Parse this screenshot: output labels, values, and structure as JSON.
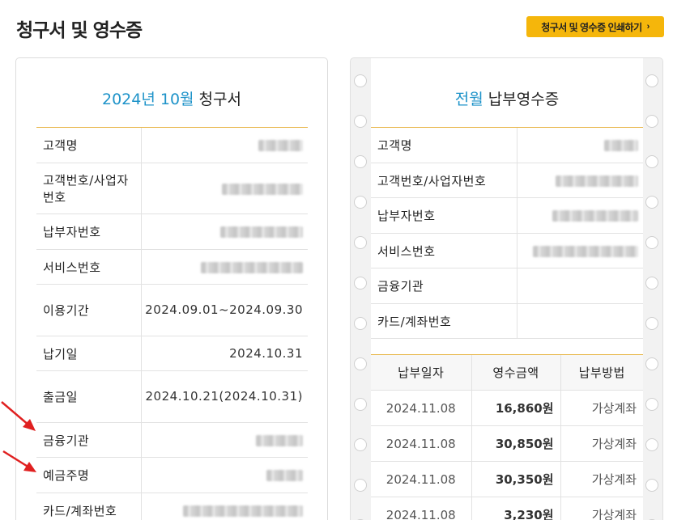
{
  "page": {
    "title": "청구서 및 영수증",
    "print_button": "청구서 및 영수증 인쇄하기"
  },
  "bill": {
    "title_accent": "2024년 10월",
    "title_rest": " 청구서",
    "rows": [
      {
        "label": "고객명",
        "value": "",
        "masked": true,
        "mask_w": 55
      },
      {
        "label": "고객번호/사업자번호",
        "value": "",
        "masked": true,
        "mask_w": 100
      },
      {
        "label": "납부자번호",
        "value": "",
        "masked": true,
        "mask_w": 102
      },
      {
        "label": "서비스번호",
        "value": "",
        "masked": true,
        "mask_w": 126
      },
      {
        "label": "이용기간",
        "value": "2024.09.01~2024.09.30",
        "masked": false
      },
      {
        "label": "납기일",
        "value": "2024.10.31",
        "masked": false
      },
      {
        "label": "출금일",
        "value": "2024.10.21(2024.10.31)",
        "masked": false
      },
      {
        "label": "금융기관",
        "value": "",
        "masked": true,
        "mask_w": 58
      },
      {
        "label": "예금주명",
        "value": "",
        "masked": true,
        "mask_w": 45
      },
      {
        "label": "카드/계좌번호",
        "value": "",
        "masked": true,
        "mask_w": 148
      }
    ]
  },
  "receipt": {
    "title_accent": "전월",
    "title_rest": " 납부영수증",
    "rows": [
      {
        "label": "고객명",
        "value": "",
        "masked": true,
        "mask_w": 42
      },
      {
        "label": "고객번호/사업자번호",
        "value": "",
        "masked": true,
        "mask_w": 102
      },
      {
        "label": "납부자번호",
        "value": "",
        "masked": true,
        "mask_w": 106
      },
      {
        "label": "서비스번호",
        "value": "",
        "masked": true,
        "mask_w": 130
      },
      {
        "label": "금융기관",
        "value": "",
        "masked": false
      },
      {
        "label": "카드/계좌번호",
        "value": "",
        "masked": false
      }
    ],
    "payments": {
      "headers": [
        "납부일자",
        "영수금액",
        "납부방법"
      ],
      "rows": [
        {
          "date": "2024.11.08",
          "amount": "16,860원",
          "method": "가상계좌"
        },
        {
          "date": "2024.11.08",
          "amount": "30,850원",
          "method": "가상계좌"
        },
        {
          "date": "2024.11.08",
          "amount": "30,350원",
          "method": "가상계좌"
        },
        {
          "date": "2024.11.08",
          "amount": "3,230원",
          "method": "가상계좌"
        }
      ]
    }
  },
  "colors": {
    "accent": "#1e93c9",
    "button": "#f5b60b",
    "table_top_rule": "#e8b74a",
    "arrow": "#e02020"
  },
  "icons": {
    "button_chevron": "chevron-right-icon",
    "annotation": "red-arrow-icon"
  }
}
